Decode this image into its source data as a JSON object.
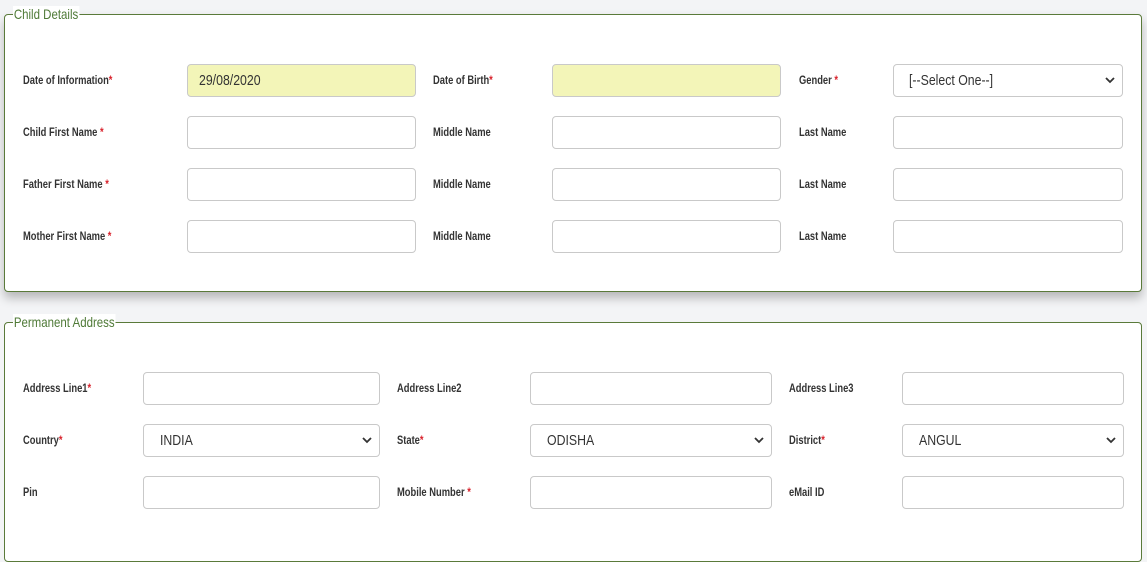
{
  "child_details": {
    "legend": "Child Details",
    "date_of_information": {
      "label": "Date of Information",
      "value": "29/08/2020"
    },
    "date_of_birth": {
      "label": "Date of Birth",
      "value": ""
    },
    "gender": {
      "label": "Gender",
      "selected": "[--Select One--]"
    },
    "child": {
      "first_label": "Child First Name",
      "middle_label": "Middle Name",
      "last_label": "Last Name"
    },
    "father": {
      "first_label": "Father First Name",
      "middle_label": "Middle Name",
      "last_label": "Last Name"
    },
    "mother": {
      "first_label": "Mother First Name",
      "middle_label": "Middle Name",
      "last_label": "Last Name"
    }
  },
  "permanent_address": {
    "legend": "Permanent Address",
    "address_line1": {
      "label": "Address Line1"
    },
    "address_line2": {
      "label": "Address Line2"
    },
    "address_line3": {
      "label": "Address Line3"
    },
    "country": {
      "label": "Country",
      "selected": "INDIA"
    },
    "state": {
      "label": "State",
      "selected": "ODISHA"
    },
    "district": {
      "label": "District",
      "selected": "ANGUL"
    },
    "pin": {
      "label": "Pin"
    },
    "mobile": {
      "label": "Mobile Number"
    },
    "email": {
      "label": "eMail ID"
    }
  },
  "required_marker": "*",
  "colors": {
    "accent_green": "#4f7a37",
    "required_red": "#d9232d",
    "date_field_bg": "#f3f5b8"
  }
}
